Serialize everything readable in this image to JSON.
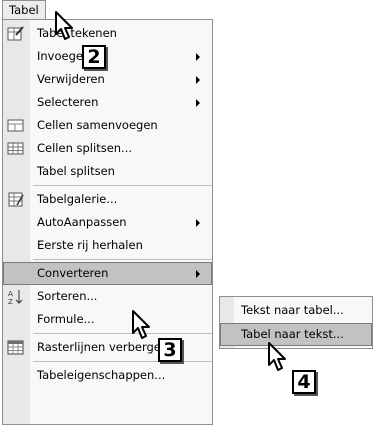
{
  "menubar": {
    "title": "Tabel"
  },
  "menu": {
    "items": [
      {
        "id": "tabel-tekenen",
        "label": "Tabel tekenen",
        "has_submenu": false,
        "icon": "pencil-table-icon"
      },
      {
        "id": "invoegen",
        "label": "Invoegen",
        "has_submenu": true
      },
      {
        "id": "verwijderen",
        "label": "Verwijderen",
        "has_submenu": true
      },
      {
        "id": "selecteren",
        "label": "Selecteren",
        "has_submenu": true
      },
      {
        "id": "cellen-samenvoegen",
        "label": "Cellen samenvoegen",
        "has_submenu": false,
        "icon": "merge-cells-icon"
      },
      {
        "id": "cellen-splitsen",
        "label": "Cellen splitsen...",
        "has_submenu": false,
        "icon": "split-cells-icon"
      },
      {
        "id": "tabel-splitsen",
        "label": "Tabel splitsen",
        "has_submenu": false
      },
      {
        "id": "tabelgalerie",
        "label": "Tabelgalerie...",
        "has_submenu": false,
        "icon": "table-gallery-icon"
      },
      {
        "id": "autoaanpassen",
        "label": "AutoAanpassen",
        "has_submenu": true
      },
      {
        "id": "eerste-rij-herhalen",
        "label": "Eerste rij herhalen",
        "has_submenu": false
      },
      {
        "id": "converteren",
        "label": "Converteren",
        "has_submenu": true,
        "highlighted": true
      },
      {
        "id": "sorteren",
        "label": "Sorteren...",
        "has_submenu": false,
        "icon": "sort-az-icon"
      },
      {
        "id": "formule",
        "label": "Formule...",
        "has_submenu": false
      },
      {
        "id": "rasterlijnen-verbergen",
        "label": "Rasterlijnen verbergen",
        "has_submenu": false,
        "icon": "gridlines-icon"
      },
      {
        "id": "tabeleigenschappen",
        "label": "Tabeleigenschappen...",
        "has_submenu": false
      }
    ]
  },
  "submenu": {
    "items": [
      {
        "id": "tekst-naar-tabel",
        "label": "Tekst naar tabel..."
      },
      {
        "id": "tabel-naar-tekst",
        "label": "Tabel naar tekst...",
        "highlighted": true
      }
    ]
  },
  "callouts": {
    "step2": "2",
    "step3": "3",
    "step4": "4"
  },
  "colors": {
    "highlight": "#c2c2c2",
    "gutter": "#e8e8e8",
    "menu_bg": "#f8f8f6",
    "border": "#8f8f8f"
  }
}
